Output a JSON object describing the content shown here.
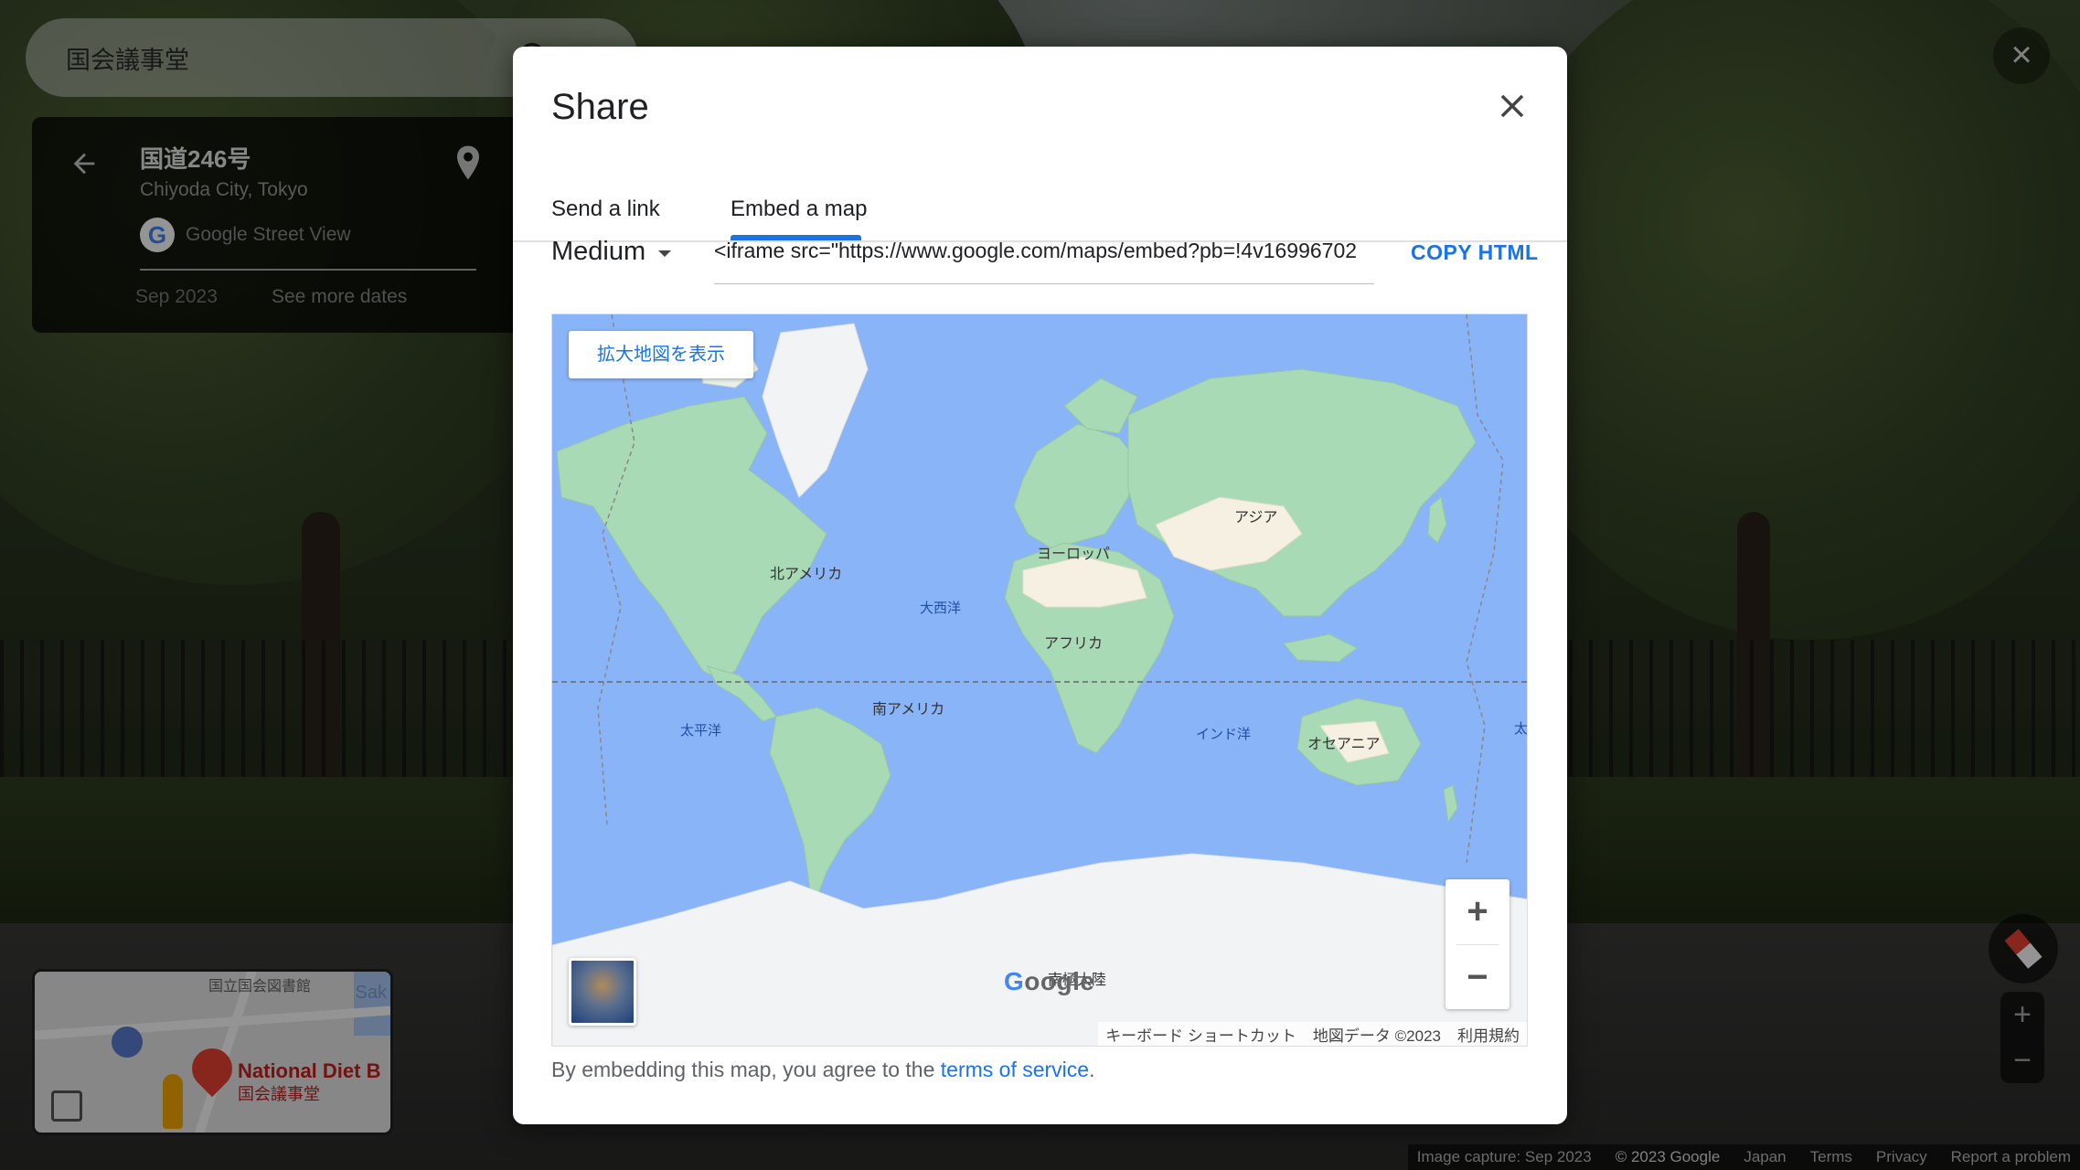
{
  "search": {
    "value": "国会議事堂"
  },
  "info": {
    "title": "国道246号",
    "subtitle": "Chiyoda City, Tokyo",
    "provider": "Google Street View",
    "date": "Sep 2023",
    "more_dates": "See more dates"
  },
  "minimap": {
    "label_library": "国立国会図書館",
    "label_place_en": "National Diet B",
    "label_place_jp": "国会議事堂",
    "label_edge": "Sak"
  },
  "street_view": {
    "close_glyph": "×",
    "zoom_in": "+",
    "zoom_out": "−"
  },
  "footer": {
    "capture": "Image capture: Sep 2023",
    "copyright": "© 2023 Google",
    "region": "Japan",
    "terms": "Terms",
    "privacy": "Privacy",
    "report": "Report a problem"
  },
  "dialog": {
    "title": "Share",
    "tabs": [
      {
        "label": "Send a link",
        "active": false
      },
      {
        "label": "Embed a map",
        "active": true
      }
    ],
    "size_selected": "Medium",
    "embed_code": "<iframe src=\"https://www.google.com/maps/embed?pb=!4v16996702",
    "copy_label": "COPY HTML",
    "legal_prefix": "By embedding this map, you agree to the ",
    "legal_link": "terms of service",
    "legal_suffix": "."
  },
  "map": {
    "view_larger": "拡大地図を表示",
    "labels": {
      "north_america": "北アメリカ",
      "europe": "ヨーロッパ",
      "asia": "アジア",
      "africa": "アフリカ",
      "south_america": "南アメリカ",
      "oceania": "オセアニア",
      "antarctica": "南極大陸",
      "atlantic": "大西洋",
      "pacific": "太平洋",
      "indian": "インド洋",
      "pacific_edge": "太"
    },
    "zoom_in": "+",
    "zoom_out": "−",
    "attribution": {
      "shortcuts": "キーボード ショートカット",
      "data": "地図データ ©2023",
      "terms": "利用規約"
    },
    "colors": {
      "ocean": "#8ab4f8",
      "land": "#a8dab5",
      "ice": "#f1f3f4",
      "desert": "#f5f0e1"
    }
  }
}
